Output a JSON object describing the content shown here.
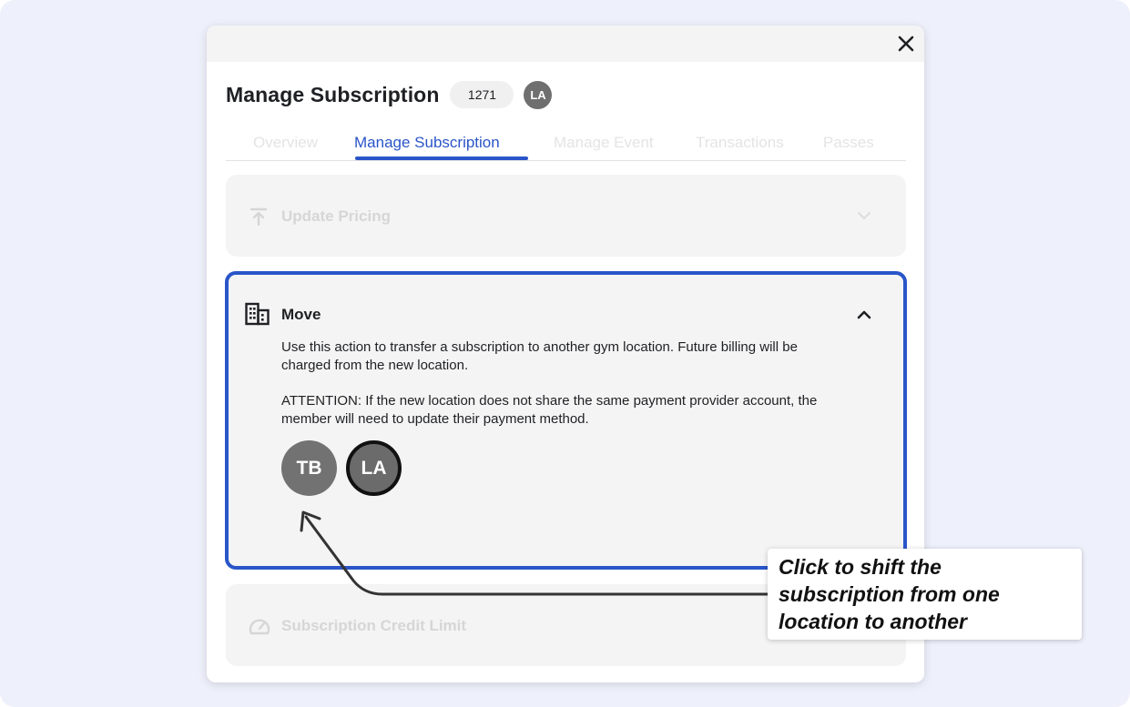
{
  "modal": {
    "title": "Manage Subscription",
    "member_id": "1271",
    "member_avatar_initials": "LA"
  },
  "tabs": [
    {
      "label": "Overview",
      "active": false
    },
    {
      "label": "Manage Subscription",
      "active": true
    },
    {
      "label": "Manage Event",
      "active": false
    },
    {
      "label": "Transactions",
      "active": false
    },
    {
      "label": "Passes",
      "active": false
    }
  ],
  "panels": {
    "update_pricing": {
      "title": "Update Pricing",
      "icon": "upload-icon"
    },
    "move": {
      "title": "Move",
      "icon": "building-icon",
      "description": "Use this action to transfer a subscription to another gym location. Future billing will be charged from the new location.",
      "attention": "ATTENTION: If the new location does not share the same payment provider account, the member will need to update their payment method.",
      "locations": [
        {
          "initials": "TB",
          "selected": false
        },
        {
          "initials": "LA",
          "selected": true
        }
      ]
    },
    "credit_limit": {
      "title": "Subscription Credit Limit",
      "icon": "gauge-icon"
    }
  },
  "callout": {
    "lines": [
      "Click to shift the",
      "subscription from one",
      "location to another"
    ]
  },
  "colors": {
    "accent": "#2a55c9",
    "background": "#eef0fb",
    "panel": "#f4f4f4"
  }
}
